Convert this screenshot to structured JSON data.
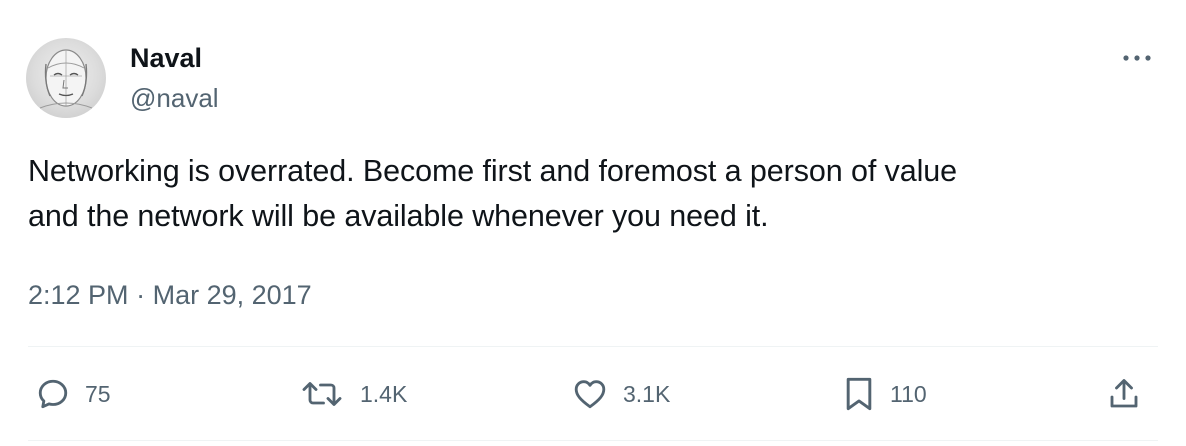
{
  "author": {
    "name": "Naval",
    "handle": "@naval"
  },
  "tweet": {
    "text": "Networking is overrated. Become first and foremost a person of value\nand the network will be available whenever you need it.",
    "time": "2:12 PM",
    "separator": "·",
    "date": "Mar 29, 2017"
  },
  "actions": {
    "replies": "75",
    "reposts": "1.4K",
    "likes": "3.1K",
    "bookmarks": "110"
  },
  "icons": {
    "more": "more-horizontal-icon",
    "reply": "reply-icon",
    "repost": "repost-icon",
    "like": "heart-icon",
    "bookmark": "bookmark-icon",
    "share": "share-icon"
  },
  "colors": {
    "text_primary": "#0f1419",
    "text_secondary": "#536471",
    "divider": "#eff3f4"
  }
}
